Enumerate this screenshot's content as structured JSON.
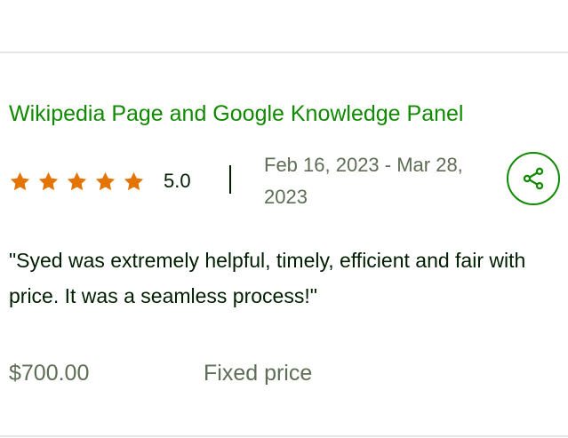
{
  "review": {
    "job_title": "Wikipedia Page and Google Knowledge Panel",
    "rating": {
      "value_label": "5.0",
      "stars_filled": 5,
      "stars_total": 5,
      "star_icon": "star-icon",
      "star_color": "#e37400"
    },
    "date_range": "Feb 16, 2023 - Mar 28, 2023",
    "share_icon": "share-icon",
    "feedback": "\"Syed was extremely helpful, timely, efficient and fair with price. It was a seamless process!\"",
    "price": "$700.00",
    "price_type": "Fixed price"
  },
  "colors": {
    "accent": "#108a00",
    "text": "#001e00",
    "muted": "#5e6d55",
    "divider": "#e4e6e8"
  }
}
